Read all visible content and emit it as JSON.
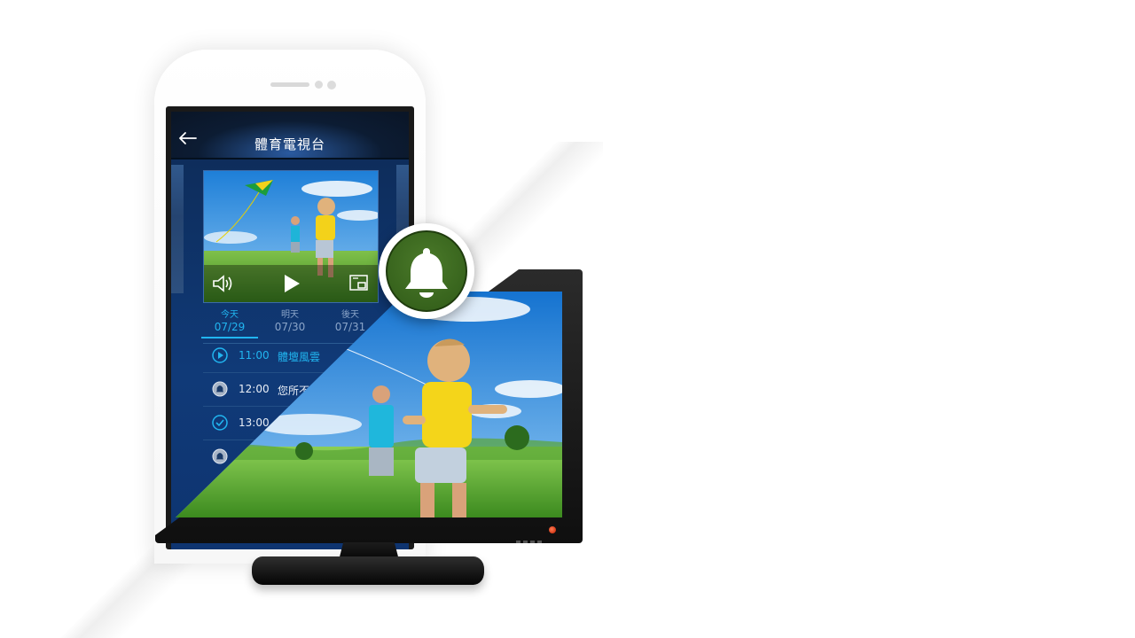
{
  "app": {
    "title": "體育電視台"
  },
  "video": {
    "controls": [
      "volume-icon",
      "play-icon",
      "pip-icon"
    ]
  },
  "days": [
    {
      "name": "今天",
      "date": "07/29",
      "active": true
    },
    {
      "name": "明天",
      "date": "07/30",
      "active": false
    },
    {
      "name": "後天",
      "date": "07/31",
      "active": false
    }
  ],
  "programs": [
    {
      "time": "11:00",
      "title": "體壇風雲",
      "icon": "play-circle-icon",
      "state": "live"
    },
    {
      "time": "12:00",
      "title": "您所不",
      "icon": "bell-circle-icon",
      "state": "reminder"
    },
    {
      "time": "13:00",
      "title": "",
      "icon": "check-circle-icon",
      "state": "set"
    },
    {
      "time": "",
      "title": "",
      "icon": "bell-circle-icon",
      "state": "reminder"
    }
  ],
  "badge": {
    "icon": "bell-icon",
    "color": "#3c6b1f"
  },
  "colors": {
    "accent": "#21b5f0",
    "app_bg": "#0f3672"
  }
}
